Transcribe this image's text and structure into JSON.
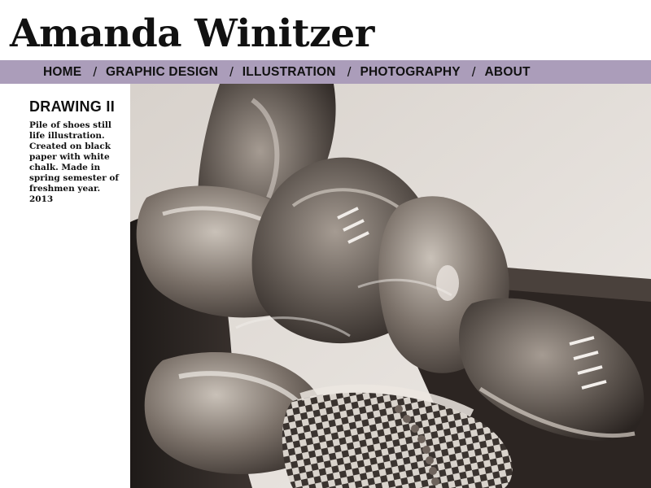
{
  "site": {
    "title": "Amanda Winitzer"
  },
  "nav": {
    "items": [
      {
        "label": "HOME"
      },
      {
        "label": "GRAPHIC DESIGN"
      },
      {
        "label": "ILLUSTRATION"
      },
      {
        "label": "PHOTOGRAPHY"
      },
      {
        "label": "ABOUT"
      }
    ],
    "separator": "/"
  },
  "work": {
    "title": "DRAWING II",
    "description": "Pile of shoes still life illustration. Created on black paper with white chalk. Made in spring semester of freshmen year. 2013",
    "image_subject": "Chalk drawing of a pile of shoes"
  },
  "colors": {
    "nav_bar": "#ab9dba",
    "text": "#111111",
    "background": "#ffffff"
  }
}
